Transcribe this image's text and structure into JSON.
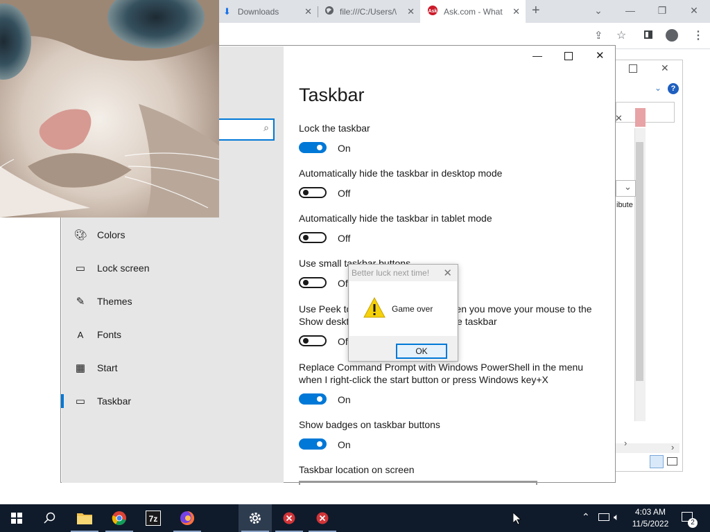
{
  "browser": {
    "tabs": [
      {
        "label": "Downloads",
        "icon": "download-icon"
      },
      {
        "label": "file:///C:/Users/\\",
        "icon": "globe-icon"
      },
      {
        "label": "Ask.com - What",
        "icon": "ask-logo-icon"
      }
    ],
    "new_tab": "+"
  },
  "settings": {
    "page_title": "Taskbar",
    "nav": [
      {
        "label": "Colors",
        "icon": "palette-icon"
      },
      {
        "label": "Lock screen",
        "icon": "lock-screen-icon"
      },
      {
        "label": "Themes",
        "icon": "themes-icon"
      },
      {
        "label": "Fonts",
        "icon": "fonts-icon"
      },
      {
        "label": "Start",
        "icon": "start-icon"
      },
      {
        "label": "Taskbar",
        "icon": "taskbar-icon",
        "selected": true
      }
    ],
    "items": [
      {
        "label": "Lock the taskbar",
        "state": "On",
        "on": true
      },
      {
        "label": "Automatically hide the taskbar in desktop mode",
        "state": "Off",
        "on": false
      },
      {
        "label": "Automatically hide the taskbar in tablet mode",
        "state": "Off",
        "on": false
      },
      {
        "label": "Use small taskbar buttons",
        "state": "Off",
        "on": false
      },
      {
        "label": "Use Peek to preview the desktop when you move your mouse to the Show desktop button at the end of the taskbar",
        "state": "Off",
        "on": false
      },
      {
        "label": "Replace Command Prompt with Windows PowerShell in the menu when I right-click the start button or press Windows key+X",
        "state": "On",
        "on": true
      },
      {
        "label": "Show badges on taskbar buttons",
        "state": "On",
        "on": true
      }
    ],
    "location_label": "Taskbar location on screen"
  },
  "dialog": {
    "title": "Better luck next time!",
    "message": "Game over",
    "ok": "OK"
  },
  "bg_window": {
    "partial_text": "ibute"
  },
  "taskbar": {
    "time": "4:03 AM",
    "date": "11/5/2022",
    "notification_count": "2",
    "apps": [
      "windows-start-icon",
      "search-icon",
      "file-explorer-icon",
      "chrome-icon",
      "7zip-icon",
      "firefox-icon",
      "settings-icon",
      "error-app-icon",
      "error-app-icon"
    ]
  },
  "colors": {
    "accent": "#0078d7",
    "taskbar": "#0f1b2b"
  }
}
